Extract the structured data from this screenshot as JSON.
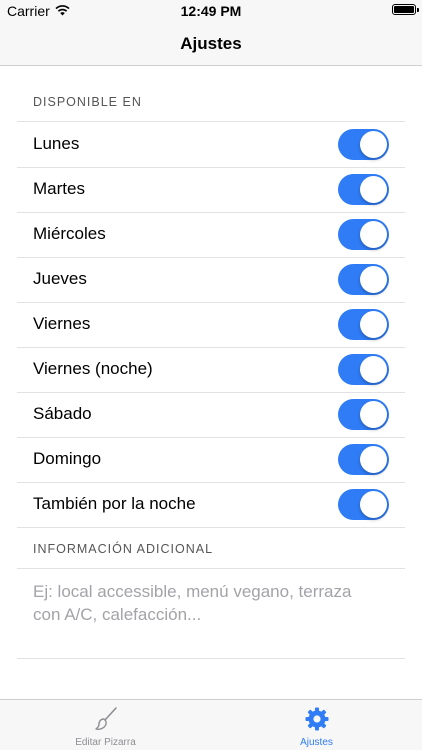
{
  "status": {
    "carrier": "Carrier",
    "time": "12:49 PM"
  },
  "nav": {
    "title": "Ajustes"
  },
  "sections": {
    "available": "DISPONIBLE EN",
    "info": "INFORMACIÓN ADICIONAL"
  },
  "days": [
    {
      "label": "Lunes",
      "on": true
    },
    {
      "label": "Martes",
      "on": true
    },
    {
      "label": "Miércoles",
      "on": true
    },
    {
      "label": "Jueves",
      "on": true
    },
    {
      "label": "Viernes",
      "on": true
    },
    {
      "label": "Viernes (noche)",
      "on": true
    },
    {
      "label": "Sábado",
      "on": true
    },
    {
      "label": "Domingo",
      "on": true
    },
    {
      "label": "También por la noche",
      "on": true
    }
  ],
  "info_field": {
    "value": "",
    "placeholder": "Ej: local accessible, menú vegano, terraza con A/C, calefacción..."
  },
  "tabs": [
    {
      "label": "Editar Pizarra",
      "icon": "brush-icon",
      "active": false
    },
    {
      "label": "Ajustes",
      "icon": "gear-icon",
      "active": true
    }
  ],
  "colors": {
    "accent": "#2f7cf6",
    "inactive": "#8e8e93"
  }
}
